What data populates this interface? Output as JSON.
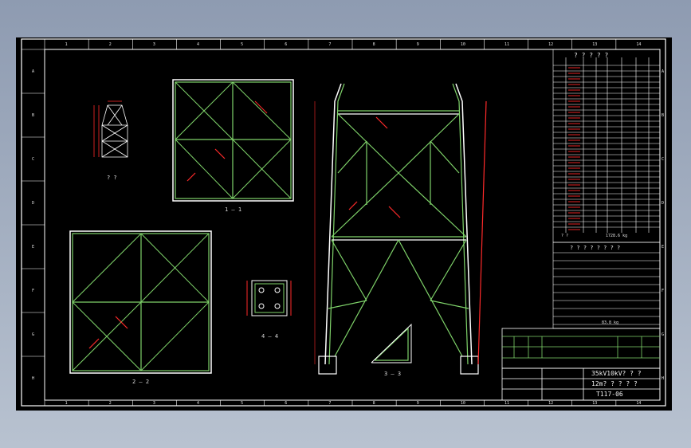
{
  "grid": {
    "columns": [
      "1",
      "2",
      "3",
      "4",
      "5",
      "6",
      "7",
      "8",
      "9",
      "10",
      "11",
      "12",
      "13",
      "14"
    ],
    "rows": [
      "A",
      "B",
      "C",
      "D",
      "E",
      "F",
      "G",
      "H"
    ]
  },
  "views": {
    "small_elev_label": "? ?",
    "plan1_label": "1 — 1",
    "plan2_label": "2 — 2",
    "bracket_label": "3 — 3",
    "plate_label": "4 — 4"
  },
  "bom": {
    "header": "? ? ? ? ?",
    "total_label": "? ?",
    "total_value": "1728.6 kg",
    "bolt_header": "? ? ? ? ? ? ? ?",
    "bolt_total": "83.8 kg"
  },
  "title_block": {
    "project": "35kV10kV? ? ?",
    "drawing_title": "12m? ? ? ? ?",
    "drawing_no": "T117-06"
  },
  "colors": {
    "frame": "#ffffff",
    "member": "#7fd36a",
    "dimension": "#ff2a2a",
    "text": "#e6e6e6",
    "background": "#000000"
  }
}
